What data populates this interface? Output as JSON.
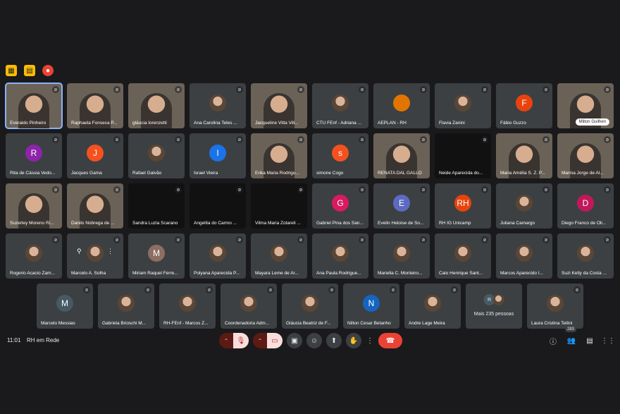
{
  "meeting": {
    "time": "11:01",
    "name": "RH em Rede",
    "participants_count": "283"
  },
  "top_icons": [
    "slides-off-icon",
    "clipboard-icon",
    "record-icon"
  ],
  "tiles": [
    {
      "name": "Everaldo Pinheiro",
      "kind": "video",
      "active": true
    },
    {
      "name": "Raphaela Fonseca P...",
      "kind": "video"
    },
    {
      "name": "gláucia lorenzetti",
      "kind": "video"
    },
    {
      "name": "Ana Carolina Teles ...",
      "kind": "photo"
    },
    {
      "name": "Jacqueline Vitta Vill...",
      "kind": "video"
    },
    {
      "name": "CTU FEnf - Adriana ...",
      "kind": "photo"
    },
    {
      "name": "AEPLAN - RH",
      "kind": "photo",
      "color": "#e37400"
    },
    {
      "name": "Flavia Zanini",
      "kind": "photo"
    },
    {
      "name": "Fábio Guzzo",
      "kind": "avatar",
      "letter": "F",
      "color": "#e8430d"
    },
    {
      "name": "Milton Guilhen",
      "kind": "video",
      "badge": true
    },
    {
      "name": "Rita de Cássia Vedo...",
      "kind": "avatar",
      "letter": "R",
      "color": "#8e24aa"
    },
    {
      "name": "Jacques Gama",
      "kind": "avatar",
      "letter": "J",
      "color": "#f4511e"
    },
    {
      "name": "Rafael Galvão",
      "kind": "photo"
    },
    {
      "name": "Israel Vieira",
      "kind": "avatar",
      "letter": "I",
      "color": "#1a73e8"
    },
    {
      "name": "Erika Maria Rodrigu...",
      "kind": "video"
    },
    {
      "name": "simone Cogo",
      "kind": "avatar",
      "letter": "s",
      "color": "#f4511e"
    },
    {
      "name": "RENATA DAL GALLO",
      "kind": "video"
    },
    {
      "name": "Neide Aparecida do...",
      "kind": "dark"
    },
    {
      "name": "Maria Amélia S. Z. P...",
      "kind": "video"
    },
    {
      "name": "Marina Jorge de Al...",
      "kind": "video"
    },
    {
      "name": "Suzerley Moreno Ri...",
      "kind": "video"
    },
    {
      "name": "Danilo Nobrega de ...",
      "kind": "video"
    },
    {
      "name": "Sandra Luzia Scarano",
      "kind": "dark"
    },
    {
      "name": "Angelita do Carmo ...",
      "kind": "dark"
    },
    {
      "name": "Vilma Maria Zotareli ...",
      "kind": "dark"
    },
    {
      "name": "Gabriel Pina dos San...",
      "kind": "avatar",
      "letter": "G",
      "color": "#d81b60"
    },
    {
      "name": "Evelin Heloise de So...",
      "kind": "avatar",
      "letter": "E",
      "color": "#5c6bc0"
    },
    {
      "name": "RH IG Unicamp",
      "kind": "avatar",
      "letter": "RH",
      "color": "#e8430d"
    },
    {
      "name": "Juliana Camargo",
      "kind": "photo"
    },
    {
      "name": "Diego Franco de Oli...",
      "kind": "avatar",
      "letter": "D",
      "color": "#c2185b"
    },
    {
      "name": "Rogerio Acacio Zam...",
      "kind": "photo"
    },
    {
      "name": "Marcelo A. Solha",
      "kind": "photo",
      "hover": true
    },
    {
      "name": "Miriam Raquel Ferre...",
      "kind": "avatar",
      "letter": "M",
      "color": "#8d6e63"
    },
    {
      "name": "Polyana Aparecida P...",
      "kind": "photo"
    },
    {
      "name": "Mayara Leme de Ar...",
      "kind": "photo"
    },
    {
      "name": "Ana Paula Rodrigue...",
      "kind": "photo"
    },
    {
      "name": "Mariella C. Monteiro...",
      "kind": "photo"
    },
    {
      "name": "Caio Henrique Sant...",
      "kind": "photo"
    },
    {
      "name": "Marcos Aparecido I...",
      "kind": "photo"
    },
    {
      "name": "Suzi Ketly da Costa ...",
      "kind": "photo"
    },
    {
      "name": "Marcelo Messias",
      "kind": "avatar",
      "letter": "M",
      "color": "#455a64"
    },
    {
      "name": "Gabriela Brioschi M...",
      "kind": "photo"
    },
    {
      "name": "RH-FEnf - Marcos Z...",
      "kind": "photo"
    },
    {
      "name": "Coordenadoria Adm...",
      "kind": "photo"
    },
    {
      "name": "Gláucia Beatriz de F...",
      "kind": "photo"
    },
    {
      "name": "Nilton Cesar Betanho",
      "kind": "avatar",
      "letter": "N",
      "color": "#1565c0"
    },
    {
      "name": "Andre Lage Meira",
      "kind": "photo"
    },
    {
      "name": "Mais 235 pessoas",
      "kind": "more"
    },
    {
      "name": "Laura Cristina Tellini",
      "kind": "photo"
    }
  ],
  "more_avatar_letter": "R",
  "hover_controls": [
    "pin-icon",
    "more-vert-icon"
  ]
}
